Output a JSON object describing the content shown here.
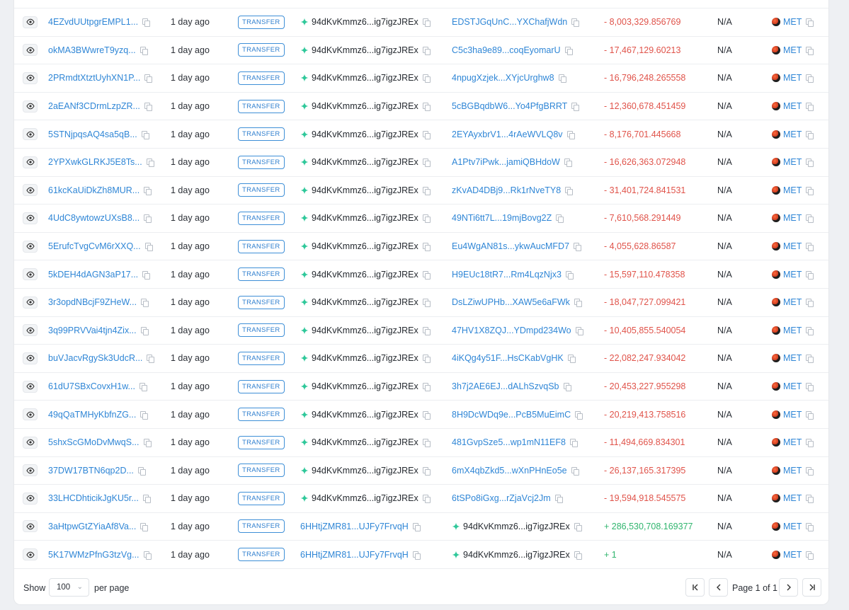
{
  "footer": {
    "show_label": "Show",
    "per_page_value": "100",
    "per_page_label": "per page",
    "page_text": "Page 1 of 1"
  },
  "colors": {
    "link": "#2f86d6",
    "negative": "#e0534a",
    "positive": "#30b56e"
  },
  "rows": [
    {
      "sig": "4EZvdUUtpgrEMPL1...",
      "time": "1 day ago",
      "action": "TRANSFER",
      "from": "94dKvKmmz6...ig7igzJREx",
      "from_icon": true,
      "to": "EDSTJGqUnC...YXChafjWdn",
      "to_icon": false,
      "amount": "- 8,003,329.856769",
      "sign": "neg",
      "value": "N/A",
      "token": "MET"
    },
    {
      "sig": "okMA3BWwreT9yzq...",
      "time": "1 day ago",
      "action": "TRANSFER",
      "from": "94dKvKmmz6...ig7igzJREx",
      "from_icon": true,
      "to": "C5c3ha9e89...coqEyomarU",
      "to_icon": false,
      "amount": "- 17,467,129.60213",
      "sign": "neg",
      "value": "N/A",
      "token": "MET"
    },
    {
      "sig": "2PRmdtXtztUyhXN1P...",
      "time": "1 day ago",
      "action": "TRANSFER",
      "from": "94dKvKmmz6...ig7igzJREx",
      "from_icon": true,
      "to": "4npugXzjek...XYjcUrghw8",
      "to_icon": false,
      "amount": "- 16,796,248.265558",
      "sign": "neg",
      "value": "N/A",
      "token": "MET"
    },
    {
      "sig": "2aEANf3CDrmLzpZR...",
      "time": "1 day ago",
      "action": "TRANSFER",
      "from": "94dKvKmmz6...ig7igzJREx",
      "from_icon": true,
      "to": "5cBGBqdbW6...Yo4PfgBRRT",
      "to_icon": false,
      "amount": "- 12,360,678.451459",
      "sign": "neg",
      "value": "N/A",
      "token": "MET"
    },
    {
      "sig": "5STNjpqsAQ4sa5qB...",
      "time": "1 day ago",
      "action": "TRANSFER",
      "from": "94dKvKmmz6...ig7igzJREx",
      "from_icon": true,
      "to": "2EYAyxbrV1...4rAeWVLQ8v",
      "to_icon": false,
      "amount": "- 8,176,701.445668",
      "sign": "neg",
      "value": "N/A",
      "token": "MET"
    },
    {
      "sig": "2YPXwkGLRKJ5E8Ts...",
      "time": "1 day ago",
      "action": "TRANSFER",
      "from": "94dKvKmmz6...ig7igzJREx",
      "from_icon": true,
      "to": "A1Ptv7iPwk...jamiQBHdoW",
      "to_icon": false,
      "amount": "- 16,626,363.072948",
      "sign": "neg",
      "value": "N/A",
      "token": "MET"
    },
    {
      "sig": "61kcKaUiDkZh8MUR...",
      "time": "1 day ago",
      "action": "TRANSFER",
      "from": "94dKvKmmz6...ig7igzJREx",
      "from_icon": true,
      "to": "zKvAD4DBj9...Rk1rNveTY8",
      "to_icon": false,
      "amount": "- 31,401,724.841531",
      "sign": "neg",
      "value": "N/A",
      "token": "MET"
    },
    {
      "sig": "4UdC8ywtowzUXsB8...",
      "time": "1 day ago",
      "action": "TRANSFER",
      "from": "94dKvKmmz6...ig7igzJREx",
      "from_icon": true,
      "to": "49NTi6tt7L...19mjBovg2Z",
      "to_icon": false,
      "amount": "- 7,610,568.291449",
      "sign": "neg",
      "value": "N/A",
      "token": "MET"
    },
    {
      "sig": "5ErufcTvgCvM6rXXQ...",
      "time": "1 day ago",
      "action": "TRANSFER",
      "from": "94dKvKmmz6...ig7igzJREx",
      "from_icon": true,
      "to": "Eu4WgAN81s...ykwAucMFD7",
      "to_icon": false,
      "amount": "- 4,055,628.86587",
      "sign": "neg",
      "value": "N/A",
      "token": "MET"
    },
    {
      "sig": "5kDEH4dAGN3aP17...",
      "time": "1 day ago",
      "action": "TRANSFER",
      "from": "94dKvKmmz6...ig7igzJREx",
      "from_icon": true,
      "to": "H9EUc18tR7...Rm4LqzNjx3",
      "to_icon": false,
      "amount": "- 15,597,110.478358",
      "sign": "neg",
      "value": "N/A",
      "token": "MET"
    },
    {
      "sig": "3r3opdNBcjF9ZHeW...",
      "time": "1 day ago",
      "action": "TRANSFER",
      "from": "94dKvKmmz6...ig7igzJREx",
      "from_icon": true,
      "to": "DsLZiwUPHb...XAW5e6aFWk",
      "to_icon": false,
      "amount": "- 18,047,727.099421",
      "sign": "neg",
      "value": "N/A",
      "token": "MET"
    },
    {
      "sig": "3q99PRVVai4tjn4Zix...",
      "time": "1 day ago",
      "action": "TRANSFER",
      "from": "94dKvKmmz6...ig7igzJREx",
      "from_icon": true,
      "to": "47HV1X8ZQJ...YDmpd234Wo",
      "to_icon": false,
      "amount": "- 10,405,855.540054",
      "sign": "neg",
      "value": "N/A",
      "token": "MET"
    },
    {
      "sig": "buVJacvRgySk3UdcR...",
      "time": "1 day ago",
      "action": "TRANSFER",
      "from": "94dKvKmmz6...ig7igzJREx",
      "from_icon": true,
      "to": "4iKQg4y51F...HsCKabVgHK",
      "to_icon": false,
      "amount": "- 22,082,247.934042",
      "sign": "neg",
      "value": "N/A",
      "token": "MET"
    },
    {
      "sig": "61dU7SBxCovxH1w...",
      "time": "1 day ago",
      "action": "TRANSFER",
      "from": "94dKvKmmz6...ig7igzJREx",
      "from_icon": true,
      "to": "3h7j2AE6EJ...dALhSzvqSb",
      "to_icon": false,
      "amount": "- 20,453,227.955298",
      "sign": "neg",
      "value": "N/A",
      "token": "MET"
    },
    {
      "sig": "49qQaTMHyKbfnZG...",
      "time": "1 day ago",
      "action": "TRANSFER",
      "from": "94dKvKmmz6...ig7igzJREx",
      "from_icon": true,
      "to": "8H9DcWDq9e...PcB5MuEimC",
      "to_icon": false,
      "amount": "- 20,219,413.758516",
      "sign": "neg",
      "value": "N/A",
      "token": "MET"
    },
    {
      "sig": "5shxScGMoDvMwqS...",
      "time": "1 day ago",
      "action": "TRANSFER",
      "from": "94dKvKmmz6...ig7igzJREx",
      "from_icon": true,
      "to": "481GvpSze5...wp1mN11EF8",
      "to_icon": false,
      "amount": "- 11,494,669.834301",
      "sign": "neg",
      "value": "N/A",
      "token": "MET"
    },
    {
      "sig": "37DW17BTN6qp2D...",
      "time": "1 day ago",
      "action": "TRANSFER",
      "from": "94dKvKmmz6...ig7igzJREx",
      "from_icon": true,
      "to": "6mX4qbZkd5...wXnPHnEo5e",
      "to_icon": false,
      "amount": "- 26,137,165.317395",
      "sign": "neg",
      "value": "N/A",
      "token": "MET"
    },
    {
      "sig": "33LHCDhticikJgKU5r...",
      "time": "1 day ago",
      "action": "TRANSFER",
      "from": "94dKvKmmz6...ig7igzJREx",
      "from_icon": true,
      "to": "6tSPo8iGxg...rZjaVcj2Jm",
      "to_icon": false,
      "amount": "- 19,594,918.545575",
      "sign": "neg",
      "value": "N/A",
      "token": "MET"
    },
    {
      "sig": "3aHtpwGtZYiaAf8Va...",
      "time": "1 day ago",
      "action": "TRANSFER",
      "from": "6HHtjZMR81...UJFy7FrvqH",
      "from_icon": false,
      "to": "94dKvKmmz6...ig7igzJREx",
      "to_icon": true,
      "amount": "+ 286,530,708.169377",
      "sign": "pos",
      "value": "N/A",
      "token": "MET"
    },
    {
      "sig": "5K17WMzPfnG3tzVg...",
      "time": "1 day ago",
      "action": "TRANSFER",
      "from": "6HHtjZMR81...UJFy7FrvqH",
      "from_icon": false,
      "to": "94dKvKmmz6...ig7igzJREx",
      "to_icon": true,
      "amount": "+ 1",
      "sign": "pos",
      "value": "N/A",
      "token": "MET"
    }
  ]
}
